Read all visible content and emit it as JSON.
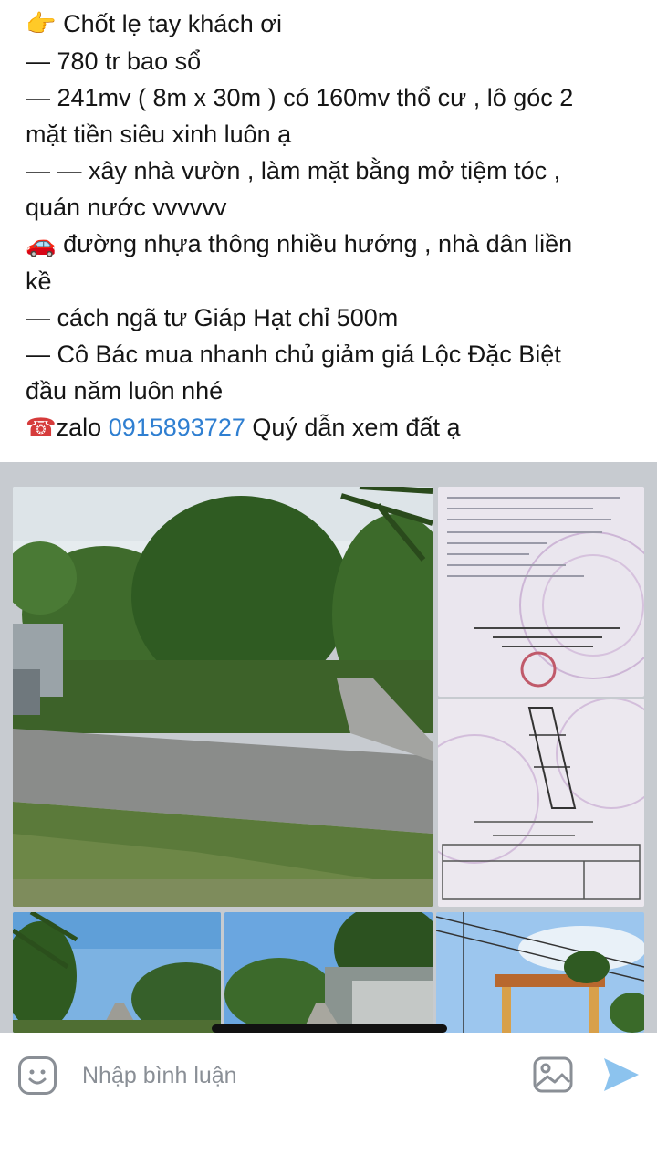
{
  "post": {
    "line1": "Chốt lẹ tay khách ơi",
    "line2": "— 780 tr bao sổ",
    "line3": "— 241mv ( 8m x 30m ) có 160mv  thổ cư , lô góc 2",
    "line4": "mặt tiền siêu xinh luôn ạ",
    "line5": "— —  xây nhà vườn , làm mặt bằng mở tiệm tóc ,",
    "line6": "quán nước vvvvvv",
    "line7": "đường nhựa thông nhiều hướng , nhà dân liền",
    "line8": "kề",
    "line9": "— cách ngã tư Giáp Hạt chỉ 500m",
    "line10": "— Cô Bác mua nhanh chủ giảm giá Lộc Đặc Biệt",
    "line11": "đầu năm luôn nhé",
    "line12_prefix": "zalo ",
    "phone": "0915893727",
    "line12_suffix": " Quý dẫn xem  đất ạ"
  },
  "icons": {
    "pointing_hand": "👉",
    "car": "🚗",
    "telephone": "☎"
  },
  "gallery": {
    "photos": [
      "road-land-photo",
      "land-certificate-photo-1",
      "land-certificate-photo-2",
      "road-photo-1",
      "road-photo-2",
      "village-gate-photo"
    ]
  },
  "composer": {
    "placeholder": "Nhập bình luận"
  },
  "colors": {
    "phone_link": "#2f7fd1",
    "send": "#8cc3ee",
    "icon_gray": "#8a8f96"
  }
}
